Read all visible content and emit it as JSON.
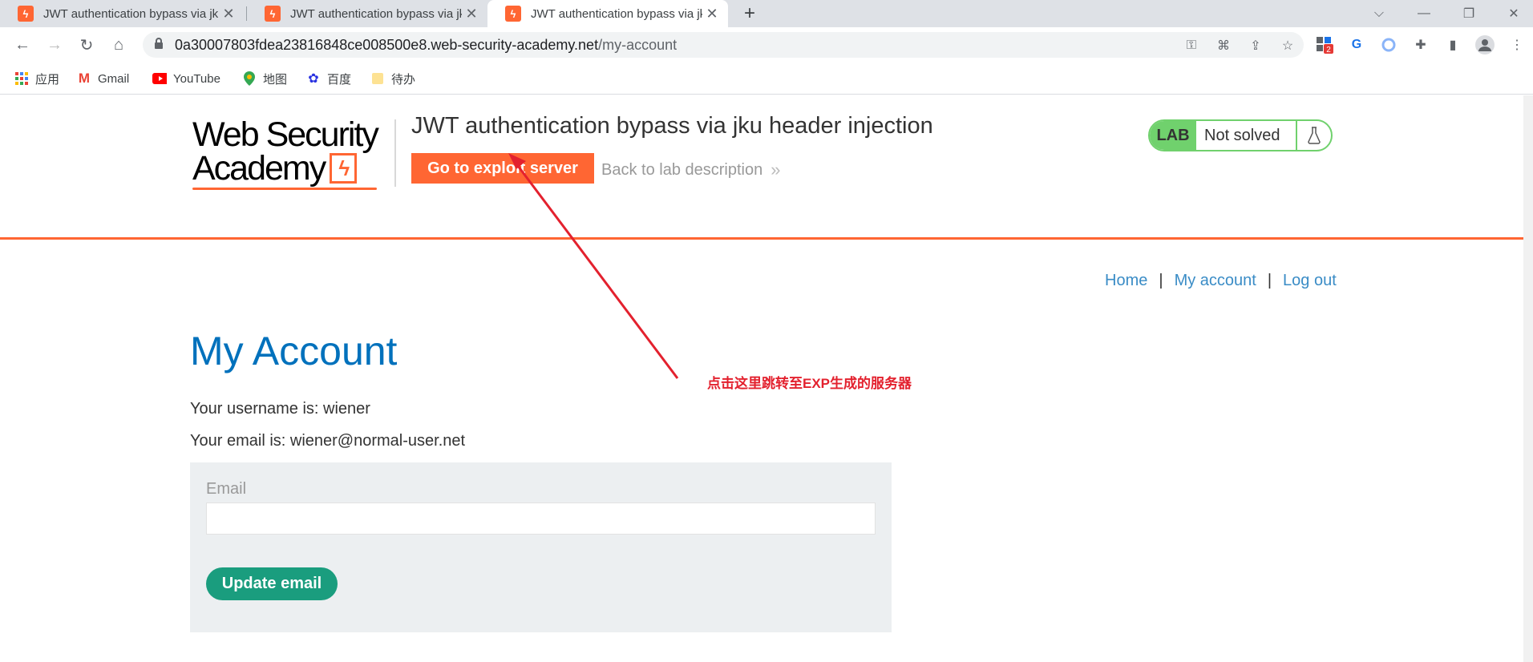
{
  "browser": {
    "tabs": [
      {
        "title": "JWT authentication bypass via jku header injection",
        "active": false
      },
      {
        "title": "JWT authentication bypass via jku header injection",
        "active": false
      },
      {
        "title": "JWT authentication bypass via jku header injection",
        "active": true
      }
    ],
    "tab_close_glyph": "✕",
    "new_tab_glyph": "+",
    "url_host": "0a30007803fdea23816848ce008500e8.web-security-academy.net",
    "url_path": "/my-account",
    "extension_badge": "2",
    "bookmarks": [
      {
        "label": "应用",
        "icon": "apps-grid-icon"
      },
      {
        "label": "Gmail",
        "icon": "gmail-icon"
      },
      {
        "label": "YouTube",
        "icon": "youtube-icon"
      },
      {
        "label": "地图",
        "icon": "maps-pin-icon"
      },
      {
        "label": "百度",
        "icon": "baidu-paw-icon"
      },
      {
        "label": "待办",
        "icon": "folder-icon"
      }
    ]
  },
  "header": {
    "logo_line1": "Web Security",
    "logo_line2": "Academy",
    "lab_title": "JWT authentication bypass via jku header injection",
    "exploit_button": "Go to exploit server",
    "back_link": "Back to lab description",
    "back_chevron": "»",
    "lab_badge": "LAB",
    "lab_status": "Not solved",
    "accent_color": "#ff6633",
    "solved_badge_color": "#70d16d"
  },
  "nav": {
    "home": "Home",
    "separator": "|",
    "my_account": "My account",
    "log_out": "Log out"
  },
  "account": {
    "heading": "My Account",
    "username_line": "Your username is: wiener",
    "email_line": "Your email is: wiener@normal-user.net",
    "email_label": "Email",
    "email_value": "",
    "update_button": "Update email"
  },
  "annotation": {
    "text": "点击这里跳转至EXP生成的服务器",
    "color": "#e3212e"
  }
}
